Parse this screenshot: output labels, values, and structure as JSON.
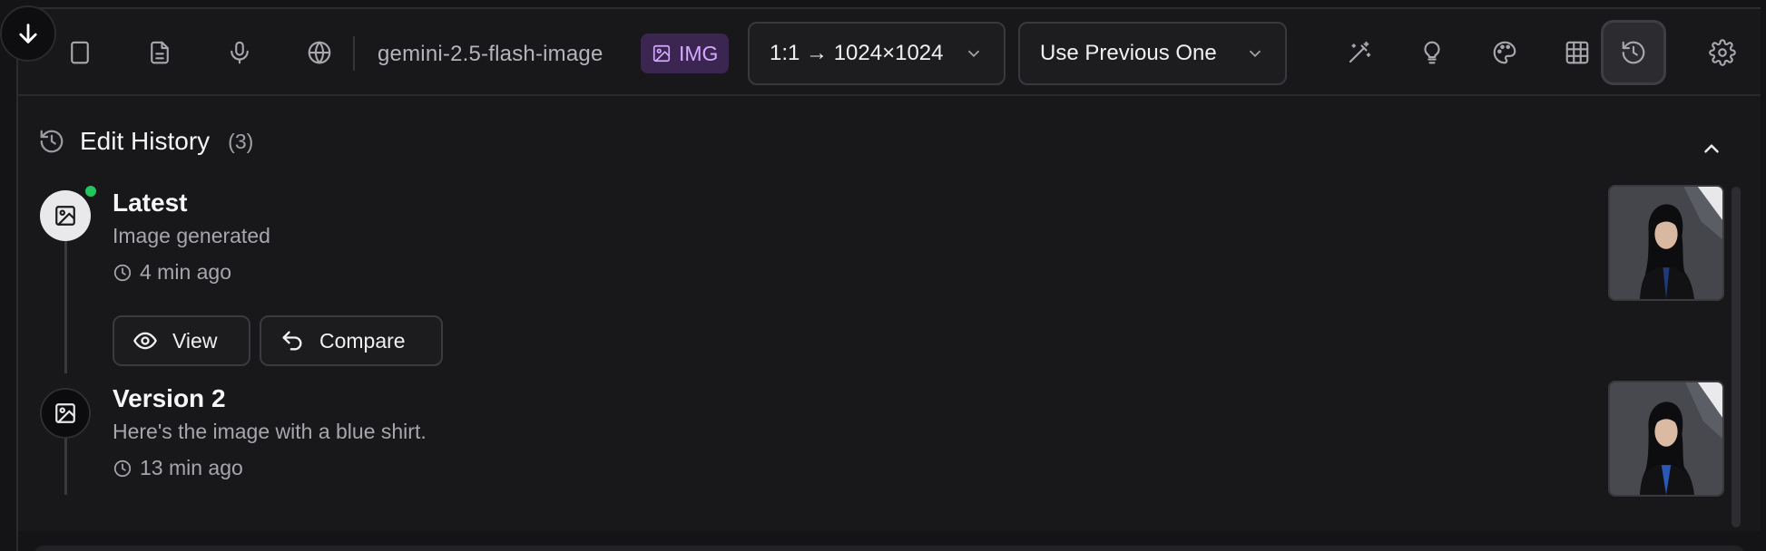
{
  "toolbar": {
    "model_name": "gemini-2.5-flash-image",
    "model_badge": "IMG",
    "ratio_select": "1:1 → 1024×1024",
    "reference_select": "Use Previous One",
    "icons": [
      "arrow-down-icon",
      "document-icon",
      "microphone-icon",
      "globe-icon",
      "magic-wand-icon",
      "lightbulb-icon",
      "palette-icon",
      "grid-icon",
      "history-icon",
      "gear-icon"
    ],
    "badge_color": "#d6a8ff"
  },
  "history": {
    "title": "Edit History",
    "count": "(3)",
    "entries": [
      {
        "title": "Latest",
        "description": "Image generated",
        "time": "4 min ago",
        "status_color": "#22c55e",
        "actions": {
          "view": "View",
          "compare": "Compare"
        }
      },
      {
        "title": "Version 2",
        "description": "Here's the image with a blue shirt.",
        "time": "13 min ago"
      }
    ]
  }
}
